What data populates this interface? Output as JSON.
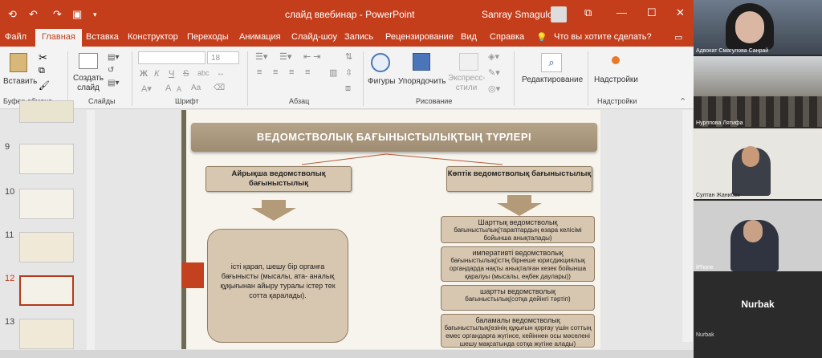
{
  "window": {
    "doc_title": "слайд ввебинар",
    "app_name": "PowerPoint",
    "title_sep": " - ",
    "user_name": "Sanray Smagulova"
  },
  "menu": {
    "tabs": [
      "Файл",
      "Главная",
      "Вставка",
      "Конструктор",
      "Переходы",
      "Анимация",
      "Слайд-шоу",
      "Запись",
      "Рецензирование",
      "Вид",
      "Справка"
    ],
    "active_tab": "Главная",
    "tell_me": "Что вы хотите сделать?"
  },
  "ribbon": {
    "clipboard": {
      "paste": "Вставить",
      "group": "Буфер обмена"
    },
    "slides": {
      "new_slide": "Создать слайд",
      "group": "Слайды"
    },
    "font": {
      "size": "18",
      "group": "Шрифт",
      "bold": "Ж",
      "italic": "К",
      "underline": "Ч",
      "strike": "S",
      "shadow": "abc",
      "grow": "A",
      "shrink": "A",
      "case": "Aa"
    },
    "paragraph": {
      "group": "Абзац"
    },
    "drawing": {
      "shapes": "Фигуры",
      "arrange": "Упорядочить",
      "styles": "Экспресс-стили",
      "group": "Рисование"
    },
    "editing": {
      "label": "Редактирование"
    },
    "addins": {
      "label": "Надстройки",
      "group": "Надстройки"
    }
  },
  "thumbnails": [
    {
      "num": "9",
      "active": false
    },
    {
      "num": "10",
      "active": false
    },
    {
      "num": "11",
      "active": false
    },
    {
      "num": "12",
      "active": true
    },
    {
      "num": "13",
      "active": false
    }
  ],
  "slide": {
    "title": "ВЕДОМСТВОЛЫҚ БАҒЫНЫСТЫЛЫҚТЫҢ ТҮРЛЕРІ",
    "left_head": "Айрықша ведомстволық бағыныстылық",
    "left_body": "істі қарап, шешу бір органға бағынысты (мысалы, ата- аналық құқығынан айыру туралы істер тек сотта қаралады).",
    "right_head": "Көптік ведомстволық бағыныстылық",
    "right_items": [
      {
        "head": "Шарттық ведомстволық",
        "body": "бағыныстылық(тараптардың өзара келісімі бойынша анықталады)"
      },
      {
        "head": "императивті ведомстволық",
        "body": "бағыныстылық(істің бірнеше юрисдикциялық органдарда нақты анықталған кезек бойынша қаралуы (мысалы, еңбек даулары))"
      },
      {
        "head": "шартты ведомстволық",
        "body": "бағыныстылық(сотқа дейінгі тәртіп)"
      },
      {
        "head": "баламалы ведомстволық",
        "body": "бағыныстылық(өзінің құқығын қорғау үшін соттың емес органдарға жүгінсе, кейіннен осы мәселені шешу мақсатында сотқа жүгіне алады)"
      }
    ]
  },
  "participants": [
    {
      "name": "Адвокат Смагулова Санрай"
    },
    {
      "name": "Нурлпова Лятифа"
    },
    {
      "name": "Султан Жанибек"
    },
    {
      "name": "iPhone"
    }
  ],
  "nurbak": {
    "big": "Nurbak",
    "small": "Nurbak"
  },
  "colors": {
    "accent": "#c43e1c",
    "slide_box": "#d8c7b0",
    "title_bar": "#a8977c"
  }
}
